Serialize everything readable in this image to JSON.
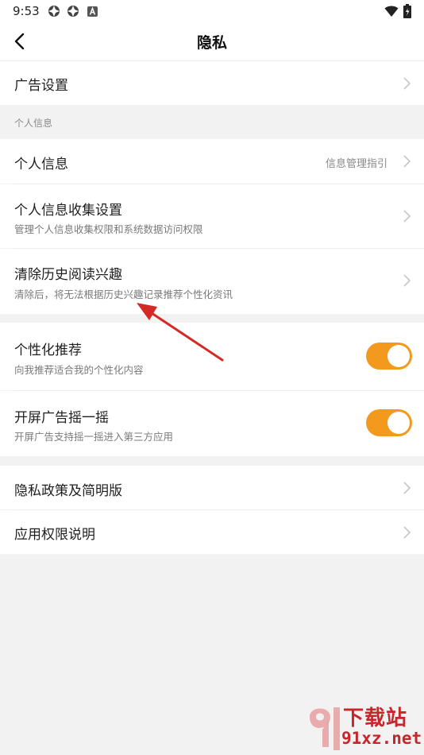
{
  "status_bar": {
    "time": "9:53"
  },
  "header": {
    "title": "隐私"
  },
  "ad_settings": {
    "label": "广告设置"
  },
  "personal_section": {
    "label": "个人信息"
  },
  "personal_info": {
    "label": "个人信息",
    "value": "信息管理指引"
  },
  "collection_settings": {
    "label": "个人信息收集设置",
    "sub": "管理个人信息收集权限和系统数据访问权限"
  },
  "clear_history": {
    "label": "清除历史阅读兴趣",
    "sub": "清除后，将无法根据历史兴趣记录推荐个性化资讯"
  },
  "personalized": {
    "label": "个性化推荐",
    "sub": "向我推荐适合我的个性化内容",
    "enabled": true
  },
  "shake_ad": {
    "label": "开屏广告摇一摇",
    "sub": "开屏广告支持摇一摇进入第三方应用",
    "enabled": true
  },
  "privacy_policy": {
    "label": "隐私政策及简明版"
  },
  "app_permissions": {
    "label": "应用权限说明"
  },
  "watermark": {
    "top_text": "下载站",
    "bottom_text": "91xz.net"
  },
  "colors": {
    "toggle_on": "#f39a1e",
    "annotation_arrow": "#d42a25"
  }
}
